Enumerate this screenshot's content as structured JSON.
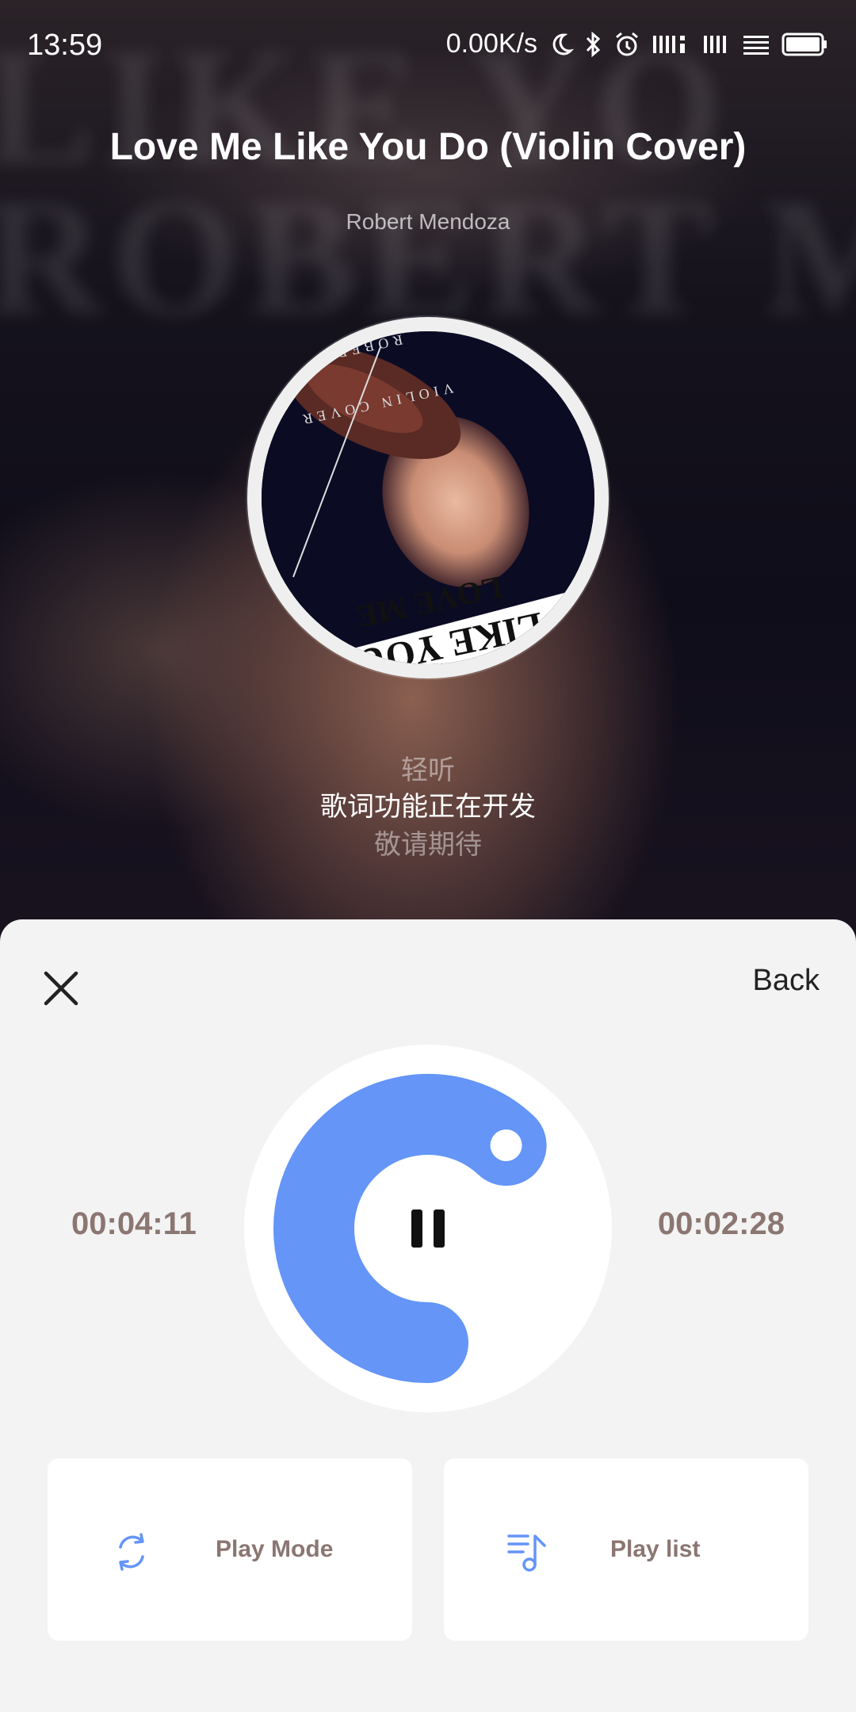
{
  "status_bar": {
    "time": "13:59",
    "network_speed": "0.00K/s",
    "icons": [
      "moon-icon",
      "bluetooth-icon",
      "alarm-icon",
      "signal-icon",
      "signal-icon",
      "wifi-icon",
      "battery-icon"
    ]
  },
  "player": {
    "title": "Love Me Like You Do (Violin Cover)",
    "artist": "Robert Mendoza",
    "album_art_text": [
      "LOVE ME",
      "LIKE YOU DO",
      "VIOLIN COVER",
      "ROBERT MENDOZA"
    ]
  },
  "lyrics": {
    "line1": "轻听",
    "line2": "歌词功能正在开发",
    "line3": "敬请期待"
  },
  "controls": {
    "back_label": "Back",
    "elapsed_time": "00:04:11",
    "remaining_time": "00:02:28",
    "progress_fraction": 0.62,
    "play_state": "paused-icon-shown",
    "play_mode_label": "Play Mode",
    "play_list_label": "Play list",
    "accent_color": "#6495f7"
  }
}
